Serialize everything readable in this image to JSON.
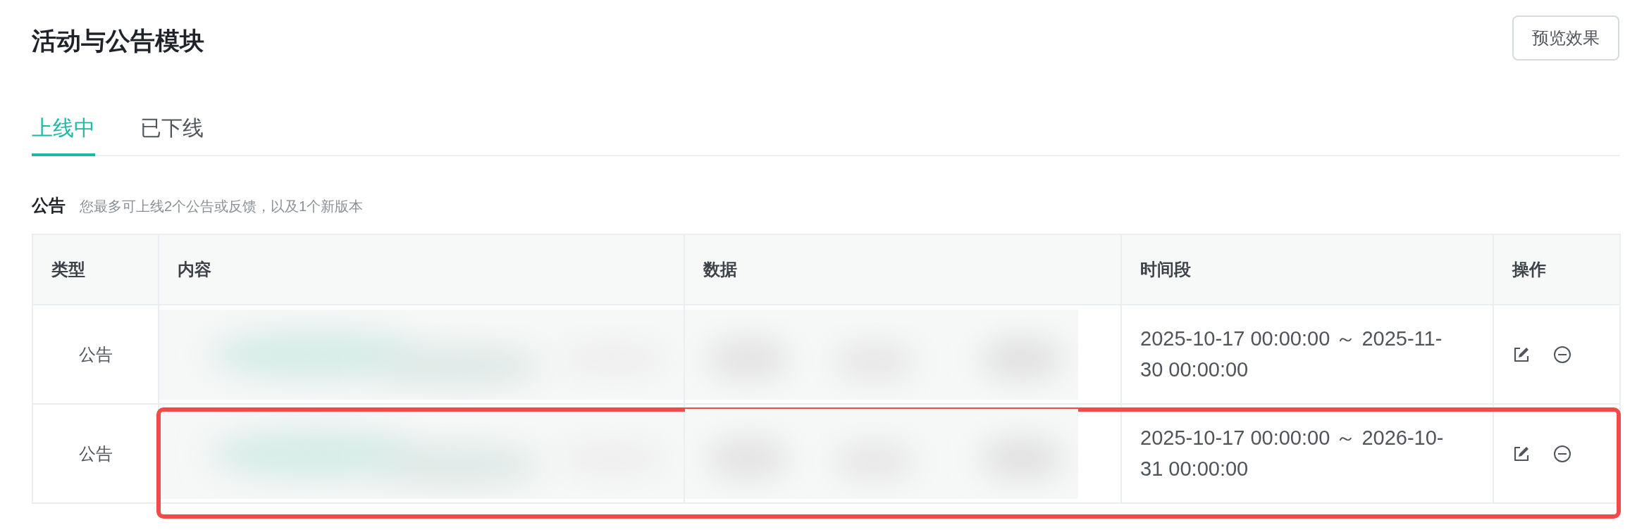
{
  "page": {
    "title": "活动与公告模块",
    "preview_button": "预览效果"
  },
  "tabs": [
    {
      "label": "上线中",
      "selected": true
    },
    {
      "label": "已下线",
      "selected": false
    }
  ],
  "section": {
    "title": "公告",
    "hint": "您最多可上线2个公告或反馈，以及1个新版本"
  },
  "table": {
    "columns": [
      "类型",
      "内容",
      "数据",
      "时间段",
      "操作"
    ],
    "rows": [
      {
        "type": "公告",
        "content": {
          "kind": "blurred"
        },
        "data": {
          "kind": "blurred"
        },
        "period": "2025-10-17 00:00:00 ～ 2025-11-30 00:00:00",
        "highlighted": false
      },
      {
        "type": "公告",
        "content": {
          "kind": "blurred"
        },
        "data": {
          "kind": "blurred"
        },
        "period": "2025-10-17 00:00:00 ～ 2026-10-31 00:00:00",
        "highlighted": true
      }
    ]
  }
}
